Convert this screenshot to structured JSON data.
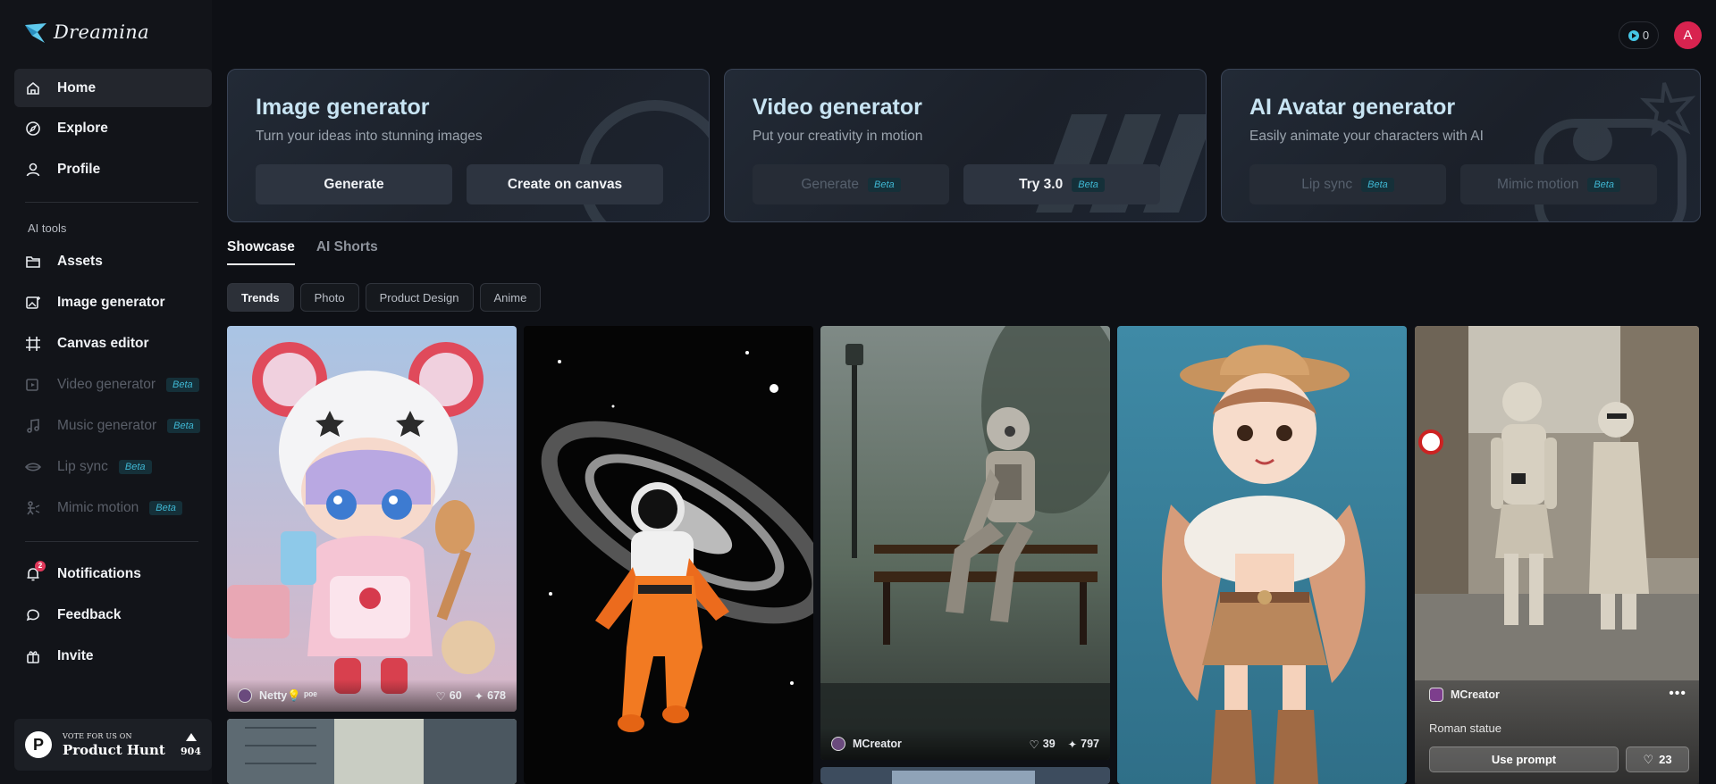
{
  "app": {
    "name": "Dreamina"
  },
  "sidebar": {
    "items": [
      {
        "label": "Home"
      },
      {
        "label": "Explore"
      },
      {
        "label": "Profile"
      }
    ],
    "section_label": "AI tools",
    "tools": [
      {
        "label": "Assets"
      },
      {
        "label": "Image generator"
      },
      {
        "label": "Canvas editor"
      },
      {
        "label": "Video generator",
        "badge": "Beta"
      },
      {
        "label": "Music generator",
        "badge": "Beta"
      },
      {
        "label": "Lip sync",
        "badge": "Beta"
      },
      {
        "label": "Mimic motion",
        "badge": "Beta"
      }
    ],
    "bottom": [
      {
        "label": "Notifications",
        "count": "2"
      },
      {
        "label": "Feedback"
      },
      {
        "label": "Invite"
      }
    ],
    "product_hunt": {
      "small": "VOTE FOR US ON",
      "big": "Product Hunt",
      "votes": "904",
      "logo_letter": "P"
    }
  },
  "topbar": {
    "credits": "0",
    "avatar_letter": "A"
  },
  "cards": [
    {
      "title": "Image generator",
      "subtitle": "Turn your ideas into stunning images",
      "btn1": "Generate",
      "btn2": "Create on canvas"
    },
    {
      "title": "Video generator",
      "subtitle": "Put your creativity in motion",
      "btn1": "Generate",
      "btn1_badge": "Beta",
      "btn2": "Try 3.0",
      "btn2_badge": "Beta"
    },
    {
      "title": "AI Avatar generator",
      "subtitle": "Easily animate your characters with AI",
      "btn1": "Lip sync",
      "btn1_badge": "Beta",
      "btn2": "Mimic motion",
      "btn2_badge": "Beta"
    }
  ],
  "tabs": [
    "Showcase",
    "AI Shorts"
  ],
  "chips": [
    "Trends",
    "Photo",
    "Product Design",
    "Anime"
  ],
  "gallery": [
    {
      "author": "Netty💡 ᵖᵒᵉ",
      "likes": "60",
      "uses": "678"
    },
    {
      "author": "MCreator",
      "likes": "39",
      "uses": "797"
    },
    {
      "author": "MCreator",
      "caption": "Roman statue",
      "use_prompt": "Use prompt",
      "likes": "23"
    }
  ],
  "colors": {
    "accent": "#3fb7d3",
    "avatar": "#d8234f",
    "background": "#0e1015",
    "card_title": "#c8e4f3"
  }
}
